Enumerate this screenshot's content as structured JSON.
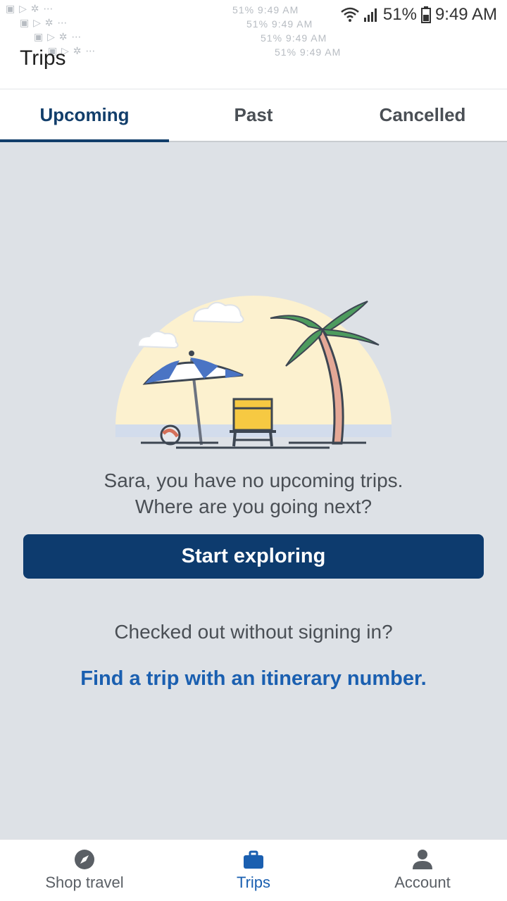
{
  "status_bar": {
    "battery": "51%",
    "time": "9:49 AM",
    "ghost_rows": [
      "51% 9:49 AM",
      "51% 9:49 AM",
      "51% 9:49 AM",
      "51% 9:49 AM"
    ]
  },
  "header": {
    "title": "Trips"
  },
  "tabs": [
    {
      "label": "Upcoming",
      "active": true
    },
    {
      "label": "Past",
      "active": false
    },
    {
      "label": "Cancelled",
      "active": false
    }
  ],
  "empty_state": {
    "line1": "Sara, you have no upcoming trips.",
    "line2": "Where are you going next?",
    "button": "Start exploring",
    "question": "Checked out without signing in?",
    "link": "Find a trip with an itinerary number."
  },
  "bottom_nav": [
    {
      "label": "Shop travel",
      "icon": "compass-icon",
      "active": false
    },
    {
      "label": "Trips",
      "icon": "briefcase-icon",
      "active": true
    },
    {
      "label": "Account",
      "icon": "person-icon",
      "active": false
    }
  ],
  "colors": {
    "brand_dark": "#0d3b6e",
    "link_blue": "#1a5fb0",
    "background": "#dde1e6"
  }
}
